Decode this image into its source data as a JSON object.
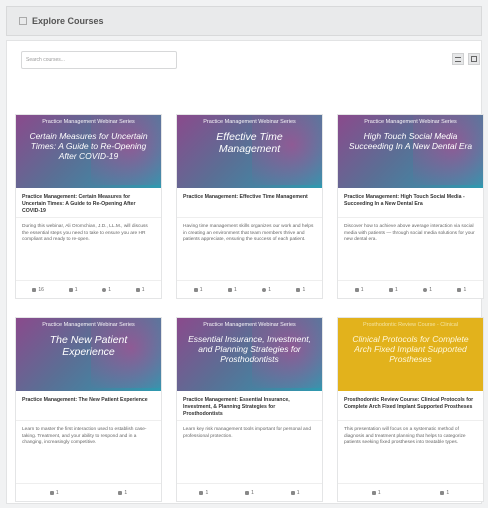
{
  "header": {
    "title": "Explore Courses",
    "icon": "square-icon"
  },
  "search": {
    "placeholder": "Search courses..."
  },
  "view_buttons": [
    {
      "icon": "list-view-icon"
    },
    {
      "icon": "grid-view-icon"
    }
  ],
  "cards": [
    {
      "series": "Practice Management Webinar Series",
      "banner_title": "Certain Measures for Uncertain Times: A Guide to Re-Opening After COVID-19",
      "title": "Practice Management: Certain Measures for Uncertain Times: A Guide to Re-Opening After COVID-19",
      "description": "During this webinar, Ali Oromchian, J.D., LL.M., will discuss the essential steps you need to take to ensure you are HR compliant and ready to re-open.",
      "stats": [
        "16",
        "1",
        "1",
        "1"
      ]
    },
    {
      "series": "Practice Management Webinar Series",
      "banner_title": "Effective Time Management",
      "title": "Practice Management: Effective Time Management",
      "description": "Having time management skills organizes our work and helps in creating an environment that team members thrive and patients appreciate, ensuring the success of each patient.",
      "stats": [
        "1",
        "1",
        "1",
        "1"
      ]
    },
    {
      "series": "Practice Management Webinar Series",
      "banner_title": "High Touch Social Media Succeeding In A New Dental Era",
      "title": "Practice Management: High Touch Social Media - Succeeding In a New Dental Era",
      "description": "Discover how to achieve above average interaction via social media with patients — through social media solutions for your new dental era.",
      "stats": [
        "1",
        "1",
        "1",
        "1"
      ]
    },
    {
      "series": "Practice Management Webinar Series",
      "banner_title": "The New Patient Experience",
      "title": "Practice Management: The New Patient Experience",
      "description": "Learn to master the first interaction used to establish case-taking. Treatment, and your ability to respond and in a changing, increasingly competitive.",
      "stats": [
        "1",
        "1"
      ]
    },
    {
      "series": "Practice Management Webinar Series",
      "banner_title": "Essential Insurance, Investment, and Planning Strategies for Prosthodontists",
      "title": "Practice Management: Essential Insurance, Investment, & Planning Strategies for Prosthodontists",
      "description": "Learn key risk management tools important for personal and professional protection.",
      "stats": [
        "1",
        "1",
        "1"
      ]
    },
    {
      "series": "Prosthodontic Review Course - Clinical",
      "banner_title": "Clinical Protocols for Complete Arch Fixed Implant Supported Prostheses",
      "title": "Prosthodontic Review Course: Clinical Protocols for Complete Arch Fixed Implant Supported Prostheses",
      "description": "This presentation will focus on a systematic method of diagnosis and treatment planning that helps to categorize patients seeking fixed prostheses into treatable types.",
      "stats": [
        "1",
        "1"
      ]
    }
  ],
  "colors": {
    "banner_gradient_start": "#8a4a8c",
    "banner_gradient_end": "#2e9ab0",
    "banner_gold": "#e2b21c"
  }
}
